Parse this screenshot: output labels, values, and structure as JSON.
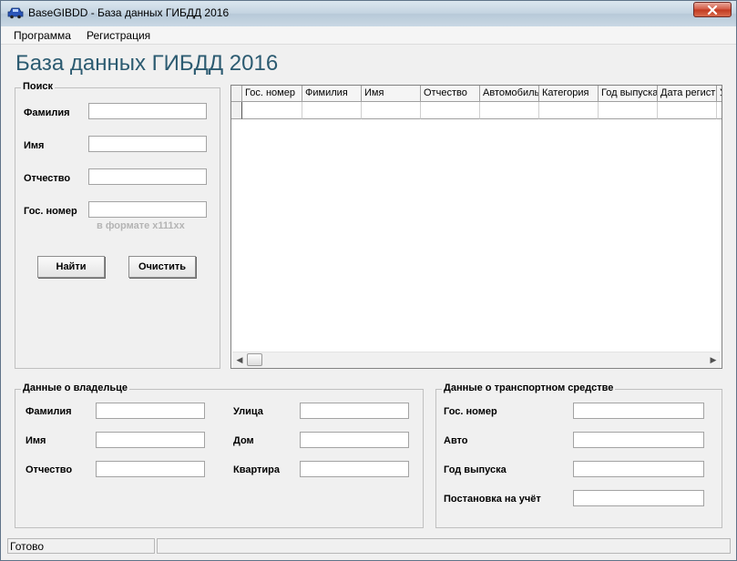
{
  "window": {
    "title": "BaseGIBDD - База данных ГИБДД  2016",
    "close_icon": "close-icon"
  },
  "menu": {
    "items": [
      "Программа",
      "Регистрация"
    ]
  },
  "app_title": "База данных ГИБДД 2016",
  "search": {
    "group_label": "Поиск",
    "fields": [
      {
        "label": "Фамилия",
        "value": ""
      },
      {
        "label": "Имя",
        "value": ""
      },
      {
        "label": "Отчество",
        "value": ""
      },
      {
        "label": "Гос. номер",
        "value": ""
      }
    ],
    "hint": "в формате х111хх",
    "find_button": "Найти",
    "clear_button": "Очистить"
  },
  "grid": {
    "columns": [
      "Гос. номер",
      "Фимилия",
      "Имя",
      "Отчество",
      "Автомобиль",
      "Категория",
      "Год выпуска",
      "Дата регист",
      "У"
    ],
    "rows": [
      [
        "",
        "",
        "",
        "",
        "",
        "",
        "",
        "",
        ""
      ]
    ]
  },
  "owner": {
    "group_label": "Данные о владельце",
    "left_fields": [
      {
        "label": "Фамилия",
        "value": ""
      },
      {
        "label": "Имя",
        "value": ""
      },
      {
        "label": "Отчество",
        "value": ""
      }
    ],
    "right_fields": [
      {
        "label": "Улица",
        "value": ""
      },
      {
        "label": "Дом",
        "value": ""
      },
      {
        "label": "Квартира",
        "value": ""
      }
    ]
  },
  "vehicle": {
    "group_label": "Данные о транспортном средстве",
    "fields": [
      {
        "label": "Гос. номер",
        "value": ""
      },
      {
        "label": "Авто",
        "value": ""
      },
      {
        "label": "Год выпуска",
        "value": ""
      },
      {
        "label": "Постановка на учёт",
        "value": ""
      }
    ]
  },
  "status": {
    "text": "Готово"
  },
  "colors": {
    "title_accent": "#2c5b71",
    "close_button": "#c0381f",
    "hint_text": "#b4b4b4"
  }
}
